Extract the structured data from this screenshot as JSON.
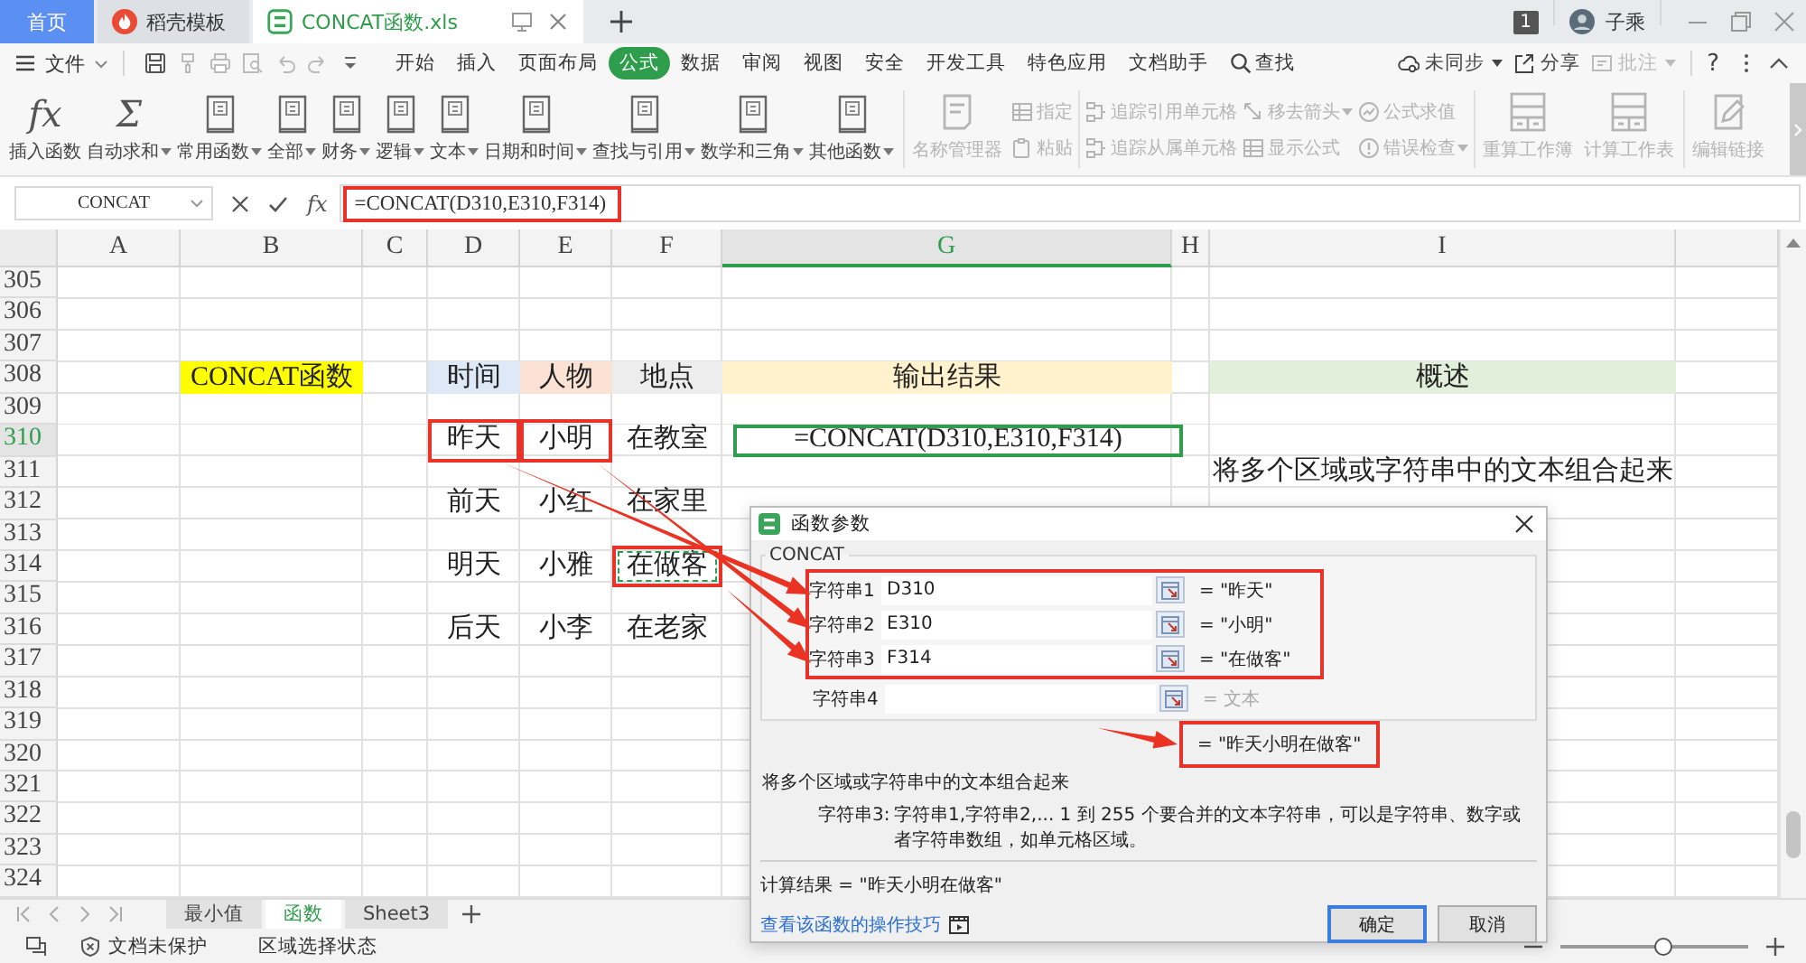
{
  "tabs": [
    {
      "label": "首页",
      "kind": "home",
      "selected": false
    },
    {
      "label": "稻壳模板",
      "kind": "docer",
      "selected": false
    },
    {
      "label": "CONCAT函数.xls",
      "kind": "sheet",
      "selected": true
    }
  ],
  "account": {
    "badge": "1",
    "user": "子乘"
  },
  "menu": {
    "file": "文件",
    "tabs": [
      {
        "label": "开始",
        "selected": false
      },
      {
        "label": "插入",
        "selected": false
      },
      {
        "label": "页面布局",
        "selected": false
      },
      {
        "label": "公式",
        "selected": true
      },
      {
        "label": "数据",
        "selected": false
      },
      {
        "label": "审阅",
        "selected": false
      },
      {
        "label": "视图",
        "selected": false
      },
      {
        "label": "安全",
        "selected": false
      },
      {
        "label": "开发工具",
        "selected": false
      },
      {
        "label": "特色应用",
        "selected": false
      },
      {
        "label": "文档助手",
        "selected": false
      }
    ],
    "search": "查找",
    "actions": [
      {
        "label": "未同步",
        "kind": "sync",
        "dropdown": true,
        "disabled": false
      },
      {
        "label": "分享",
        "kind": "share",
        "dropdown": false,
        "disabled": false
      },
      {
        "label": "批注",
        "kind": "comment",
        "dropdown": true,
        "disabled": true
      }
    ],
    "help": "?"
  },
  "ribbon": {
    "functions": [
      {
        "label": "插入函数",
        "kind": "glyph",
        "glyph": "fx",
        "dropdown": false
      },
      {
        "label": "自动求和",
        "kind": "glyph",
        "glyph": "Σ",
        "dropdown": true
      },
      {
        "label": "常用函数",
        "kind": "book",
        "dropdown": true
      },
      {
        "label": "全部",
        "kind": "book",
        "dropdown": true
      },
      {
        "label": "财务",
        "kind": "book",
        "dropdown": true
      },
      {
        "label": "逻辑",
        "kind": "book",
        "dropdown": true
      },
      {
        "label": "文本",
        "kind": "book",
        "dropdown": true
      },
      {
        "label": "日期和时间",
        "kind": "book",
        "dropdown": true
      },
      {
        "label": "查找与引用",
        "kind": "book",
        "dropdown": true
      },
      {
        "label": "数学和三角",
        "kind": "book",
        "dropdown": true
      },
      {
        "label": "其他函数",
        "kind": "book",
        "dropdown": true
      }
    ],
    "tool_groups": [
      {
        "columns": [
          {
            "items": [
              {
                "label": "名称管理器",
                "kind": "document",
                "dropdown": false,
                "disabled": true
              }
            ]
          },
          {
            "items": [
              {
                "label": "指定",
                "kind": "grid",
                "dropdown": false,
                "disabled": true
              },
              {
                "label": "粘贴",
                "kind": "clipboard",
                "dropdown": false,
                "disabled": true
              }
            ]
          }
        ]
      },
      {
        "columns": [
          {
            "items": [
              {
                "label": "追踪引用单元格",
                "kind": "trace",
                "dropdown": false,
                "disabled": true
              },
              {
                "label": "追踪从属单元格",
                "kind": "trace",
                "dropdown": false,
                "disabled": true
              }
            ]
          },
          {
            "items": [
              {
                "label": "移去箭头",
                "kind": "arrow",
                "dropdown": true,
                "disabled": true
              },
              {
                "label": "显示公式",
                "kind": "grid",
                "dropdown": false,
                "disabled": true
              }
            ]
          },
          {
            "items": [
              {
                "label": "公式求值",
                "kind": "gauge",
                "dropdown": false,
                "disabled": true
              },
              {
                "label": "错误检查",
                "kind": "warning",
                "dropdown": true,
                "disabled": true
              }
            ]
          }
        ]
      },
      {
        "columns": [
          {
            "items": [
              {
                "label": "重算工作簿",
                "kind": "calc",
                "dropdown": false,
                "disabled": true
              }
            ]
          },
          {
            "items": [
              {
                "label": "计算工作表",
                "kind": "calc",
                "dropdown": false,
                "disabled": true
              }
            ]
          }
        ]
      },
      {
        "columns": [
          {
            "items": [
              {
                "label": "编辑链接",
                "kind": "edit",
                "dropdown": false,
                "disabled": true
              }
            ]
          }
        ]
      }
    ]
  },
  "formula_bar": {
    "name_box": "CONCAT",
    "fx": "fx",
    "formula": "=CONCAT(D310,E310,F314)",
    "annotated": true
  },
  "sheet": {
    "columns": [
      {
        "label": "A",
        "selected": false
      },
      {
        "label": "B",
        "selected": false
      },
      {
        "label": "C",
        "selected": false
      },
      {
        "label": "D",
        "selected": false
      },
      {
        "label": "E",
        "selected": false
      },
      {
        "label": "F",
        "selected": false
      },
      {
        "label": "G",
        "selected": true
      },
      {
        "label": "H",
        "selected": false
      },
      {
        "label": "I",
        "selected": false
      }
    ],
    "rows": [
      {
        "label": "305",
        "selected": false
      },
      {
        "label": "306",
        "selected": false
      },
      {
        "label": "307",
        "selected": false
      },
      {
        "label": "308",
        "selected": false,
        "cells": {
          "B": {
            "text": "CONCAT函数",
            "color": "#ffff00",
            "annotated": false,
            "active": false,
            "marquee": false
          },
          "D": {
            "text": "时间",
            "color": "#dde9f7",
            "annotated": false,
            "active": false,
            "marquee": false
          },
          "E": {
            "text": "人物",
            "color": "#fbe2d5",
            "annotated": false,
            "active": false,
            "marquee": false
          },
          "F": {
            "text": "地点",
            "color": "#ededed",
            "annotated": false,
            "active": false,
            "marquee": false
          },
          "G": {
            "text": "输出结果",
            "color": "#fff2cc",
            "annotated": false,
            "active": false,
            "marquee": false
          },
          "I": {
            "text": "概述",
            "color": "#e2efda",
            "annotated": false,
            "active": false,
            "marquee": false
          }
        }
      },
      {
        "label": "309",
        "selected": false
      },
      {
        "label": "310",
        "selected": true,
        "cells": {
          "D": {
            "text": "昨天",
            "annotated": true,
            "active": false,
            "marquee": false
          },
          "E": {
            "text": "小明",
            "annotated": true,
            "active": false,
            "marquee": false
          },
          "F": {
            "text": "在教室",
            "annotated": false,
            "active": false,
            "marquee": false
          },
          "G": {
            "text": "=CONCAT(D310,E310,F314)",
            "annotated": false,
            "active": true,
            "marquee": false
          }
        }
      },
      {
        "label": "311",
        "selected": false,
        "cells": {
          "I": {
            "text": "将多个区域或字符串中的文本组合起来",
            "annotated": false,
            "active": false,
            "marquee": false
          }
        }
      },
      {
        "label": "312",
        "selected": false,
        "cells": {
          "D": {
            "text": "前天",
            "annotated": false,
            "active": false,
            "marquee": false
          },
          "E": {
            "text": "小红",
            "annotated": false,
            "active": false,
            "marquee": false
          },
          "F": {
            "text": "在家里",
            "annotated": false,
            "active": false,
            "marquee": false
          }
        }
      },
      {
        "label": "313",
        "selected": false
      },
      {
        "label": "314",
        "selected": false,
        "cells": {
          "D": {
            "text": "明天",
            "annotated": false,
            "active": false,
            "marquee": false
          },
          "E": {
            "text": "小雅",
            "annotated": false,
            "active": false,
            "marquee": false
          },
          "F": {
            "text": "在做客",
            "annotated": true,
            "active": false,
            "marquee": true
          }
        }
      },
      {
        "label": "315",
        "selected": false
      },
      {
        "label": "316",
        "selected": false,
        "cells": {
          "D": {
            "text": "后天",
            "annotated": false,
            "active": false,
            "marquee": false
          },
          "E": {
            "text": "小李",
            "annotated": false,
            "active": false,
            "marquee": false
          },
          "F": {
            "text": "在老家",
            "annotated": false,
            "active": false,
            "marquee": false
          }
        }
      },
      {
        "label": "317",
        "selected": false
      },
      {
        "label": "318",
        "selected": false
      },
      {
        "label": "319",
        "selected": false
      },
      {
        "label": "320",
        "selected": false
      },
      {
        "label": "321",
        "selected": false
      },
      {
        "label": "322",
        "selected": false
      },
      {
        "label": "323",
        "selected": false
      },
      {
        "label": "324",
        "selected": false
      }
    ]
  },
  "sheet_tabs": [
    {
      "label": "最小值",
      "selected": false
    },
    {
      "label": "函数",
      "selected": true
    },
    {
      "label": "Sheet3",
      "selected": false
    }
  ],
  "status_bar": {
    "protection": "文档未保护",
    "mode": "区域选择状态",
    "zoom": {
      "level": 0.55
    }
  },
  "dialog": {
    "title": "函数参数",
    "function": "CONCAT",
    "args": [
      {
        "label": "字符串1",
        "value": "D310",
        "result": "= \"昨天\"",
        "hint": false,
        "annotated": true
      },
      {
        "label": "字符串2",
        "value": "E310",
        "result": "= \"小明\"",
        "hint": false,
        "annotated": true
      },
      {
        "label": "字符串3",
        "value": "F314",
        "result": "= \"在做客\"",
        "hint": false,
        "annotated": true
      },
      {
        "label": "字符串4",
        "result": "= 文本",
        "hint": true,
        "annotated": false
      }
    ],
    "result": {
      "text": "= \"昨天小明在做客\"",
      "annotated": true
    },
    "description": "将多个区域或字符串中的文本组合起来",
    "arg_help": {
      "label": "字符串3:",
      "text": "字符串1,字符串2,... 1 到 255 个要合并的文本字符串，可以是字符串、数字或者字符串数组，如单元格区域。"
    },
    "computed": "计算结果 = \"昨天小明在做客\"",
    "link": "查看该函数的操作技巧",
    "buttons": [
      {
        "label": "确定",
        "default": true
      },
      {
        "label": "取消",
        "default": false
      }
    ]
  }
}
